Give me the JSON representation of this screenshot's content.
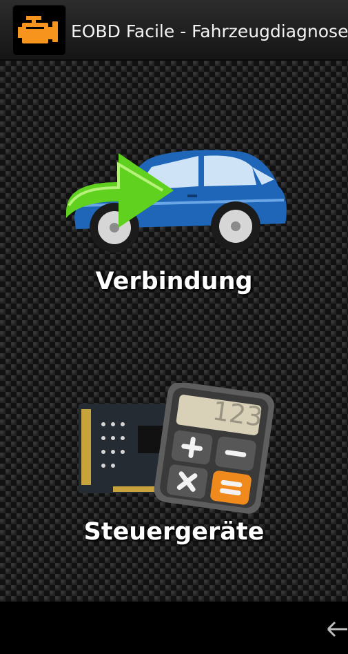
{
  "action_bar": {
    "title": "EOBD Facile - Fahrzeugdiagnose",
    "app_icon": "engine-check-icon"
  },
  "menu": {
    "items": [
      {
        "label": "Verbindung",
        "icon": "car-connect-icon"
      },
      {
        "label": "Steuergeräte",
        "icon": "ecu-calculator-icon"
      }
    ]
  },
  "calculator_display": "123",
  "nav_bar": {
    "back_icon": "back-arrow-icon"
  },
  "colors": {
    "accent": "#f7941d",
    "car_blue": "#1f66b8",
    "arrow_green": "#5fd11e",
    "calc_orange": "#f08a1c"
  }
}
